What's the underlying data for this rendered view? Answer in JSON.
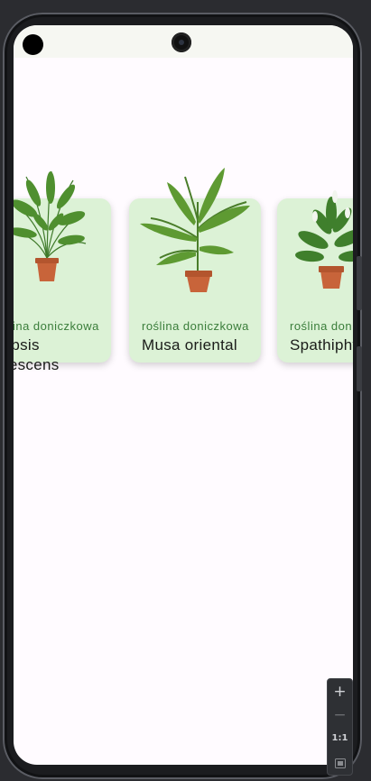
{
  "cards": [
    {
      "category": "roślina doniczkowa",
      "name_line1": "Dypsis",
      "name_line2": "lutescens",
      "plant": "areca-palm"
    },
    {
      "category": "roślina doniczkowa",
      "name_line1": "Musa oriental",
      "name_line2": "",
      "plant": "banana-plant"
    },
    {
      "category": "roślina doniczkowa",
      "name_line1": "Spathiphyllum",
      "name_line2": "",
      "plant": "peace-lily"
    }
  ],
  "zoom": {
    "in": "+",
    "out": "−",
    "reset": "1:1"
  },
  "colors": {
    "card": "#dcf2d6",
    "category_text": "#3a7d3a",
    "pot": "#c8643a"
  }
}
